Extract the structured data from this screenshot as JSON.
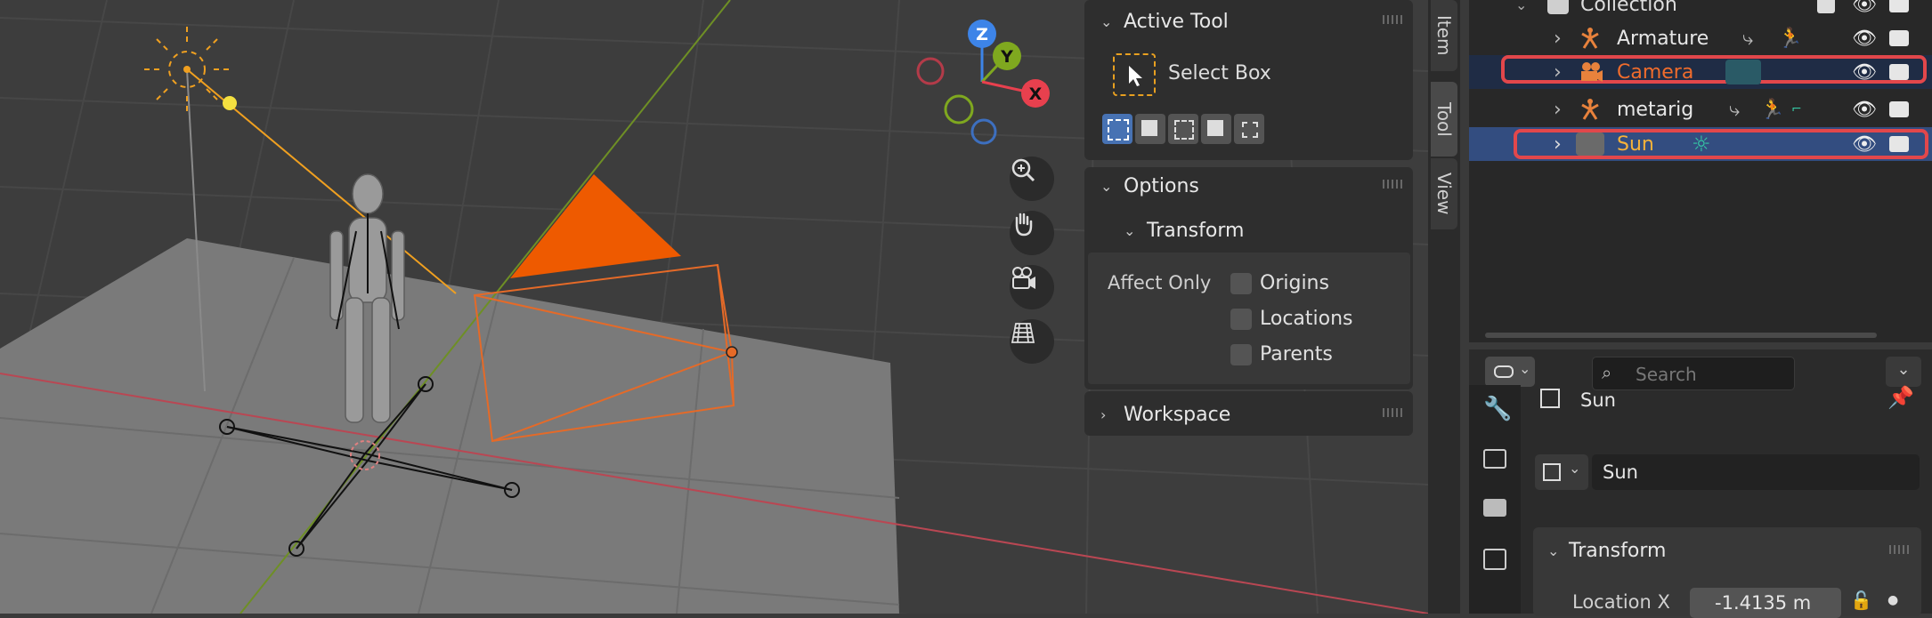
{
  "viewport": {
    "gizmo": {
      "z": "Z",
      "y": "Y",
      "x": "X"
    },
    "nav_buttons": [
      "zoom-icon",
      "hand-pan-icon",
      "camera-view-icon",
      "grid-ortho-icon"
    ]
  },
  "npanel": {
    "active_tool": {
      "header": "Active Tool",
      "tool_name": "Select Box"
    },
    "options": {
      "header": "Options",
      "transform_header": "Transform",
      "affect_only_label": "Affect Only",
      "checkboxes": [
        {
          "label": "Origins",
          "checked": false
        },
        {
          "label": "Locations",
          "checked": false
        },
        {
          "label": "Parents",
          "checked": false
        }
      ]
    },
    "workspace": {
      "header": "Workspace"
    }
  },
  "sidebar_tabs": [
    "Item",
    "Tool",
    "View"
  ],
  "outliner": {
    "collection": "Collection",
    "rows": [
      {
        "name": "Armature",
        "selected": false,
        "highlight": false
      },
      {
        "name": "Camera",
        "selected": false,
        "highlight": true
      },
      {
        "name": "metarig",
        "selected": false,
        "highlight": false
      },
      {
        "name": "Sun",
        "selected": true,
        "highlight": true
      }
    ]
  },
  "properties": {
    "search_placeholder": "Search",
    "object_name": "Sun",
    "data_name": "Sun",
    "transform_header": "Transform",
    "location_x_label": "Location X",
    "location_x_value": "-1.4135 m"
  },
  "colors": {
    "accent_orange": "#e8590c",
    "selection_blue": "#334d80",
    "highlight_red": "#e2474b",
    "axis_x": "#e8404e",
    "axis_y": "#7fa81f",
    "axis_z": "#3d84e8"
  }
}
